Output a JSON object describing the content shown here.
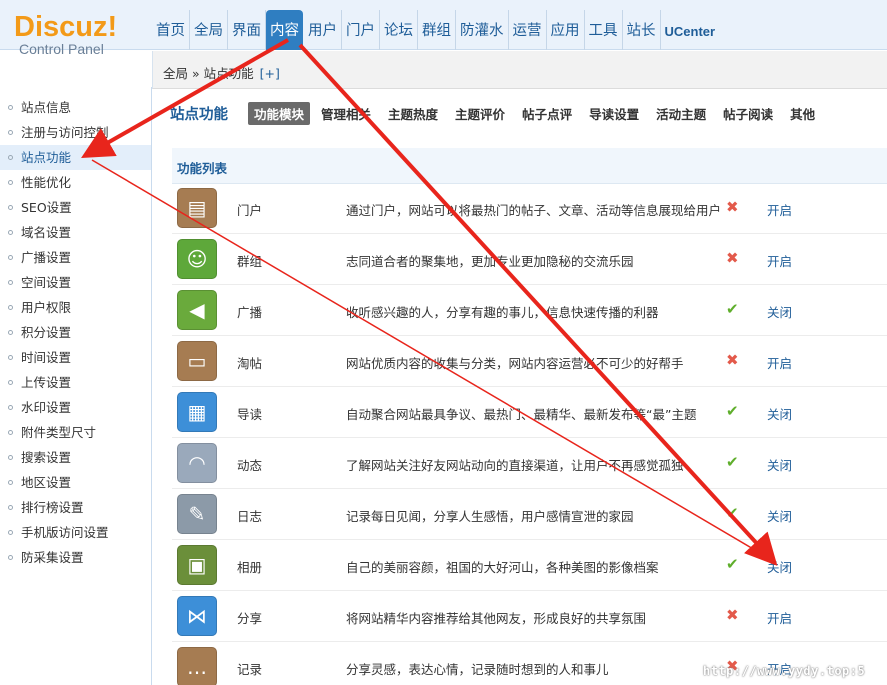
{
  "header": {
    "logo": {
      "main": "Discuz!",
      "sub": "Control Panel"
    },
    "nav": [
      "首页",
      "全局",
      "界面",
      "内容",
      "用户",
      "门户",
      "论坛",
      "群组",
      "防灌水",
      "运营",
      "应用",
      "工具",
      "站长",
      "UCenter"
    ],
    "active_nav": "内容"
  },
  "breadcrumb": {
    "path": "全局 » 站点功能",
    "add": "[+]"
  },
  "sidebar": {
    "items": [
      "站点信息",
      "注册与访问控制",
      "站点功能",
      "性能优化",
      "SEO设置",
      "域名设置",
      "广播设置",
      "空间设置",
      "用户权限",
      "积分设置",
      "时间设置",
      "上传设置",
      "水印设置",
      "附件类型尺寸",
      "搜索设置",
      "地区设置",
      "排行榜设置",
      "手机版访问设置",
      "防采集设置"
    ],
    "active": "站点功能"
  },
  "main": {
    "title": "站点功能",
    "tabs": [
      "功能模块",
      "管理相关",
      "主题热度",
      "主题评价",
      "帖子点评",
      "导读设置",
      "活动主题",
      "帖子阅读",
      "其他"
    ],
    "active_tab": "功能模块",
    "list_title": "功能列表",
    "rows": [
      {
        "name": "门户",
        "desc": "通过门户，网站可以将最热门的帖子、文章、活动等信息展现给用户",
        "enabled": false,
        "action": "开启",
        "icon": "portal-icon",
        "color": "#a67c52"
      },
      {
        "name": "群组",
        "desc": "志同道合者的聚集地，更加专业更加隐秘的交流乐园",
        "enabled": false,
        "action": "开启",
        "icon": "group-icon",
        "color": "#5ea83a"
      },
      {
        "name": "广播",
        "desc": "收听感兴趣的人，分享有趣的事儿，信息快速传播的利器",
        "enabled": true,
        "action": "关闭",
        "icon": "megaphone-icon",
        "color": "#6aaa3c"
      },
      {
        "name": "淘帖",
        "desc": "网站优质内容的收集与分类，网站内容运营必不可少的好帮手",
        "enabled": false,
        "action": "开启",
        "icon": "collection-icon",
        "color": "#a67c52"
      },
      {
        "name": "导读",
        "desc": "自动聚合网站最具争议、最热门、最精华、最新发布等“最”主题",
        "enabled": true,
        "action": "关闭",
        "icon": "guide-icon",
        "color": "#3d8fd8"
      },
      {
        "name": "动态",
        "desc": "了解网站关注好友网站动向的直接渠道，让用户不再感觉孤独",
        "enabled": true,
        "action": "关闭",
        "icon": "rss-icon",
        "color": "#9aa9bb"
      },
      {
        "name": "日志",
        "desc": "记录每日见闻，分享人生感悟，用户感情宣泄的家园",
        "enabled": true,
        "action": "关闭",
        "icon": "blog-icon",
        "color": "#8c9aa8"
      },
      {
        "name": "相册",
        "desc": "自己的美丽容颜，祖国的大好河山，各种美图的影像档案",
        "enabled": true,
        "action": "关闭",
        "icon": "album-icon",
        "color": "#6b8f3a"
      },
      {
        "name": "分享",
        "desc": "将网站精华内容推荐给其他网友，形成良好的共享氛围",
        "enabled": false,
        "action": "开启",
        "icon": "share-icon",
        "color": "#3d8fd8"
      },
      {
        "name": "记录",
        "desc": "分享灵感，表达心情，记录随时想到的人和事儿",
        "enabled": false,
        "action": "开启",
        "icon": "speech-bubble-icon",
        "color": "#a67c52"
      }
    ]
  },
  "watermark": "http://www.yydy.top:5"
}
